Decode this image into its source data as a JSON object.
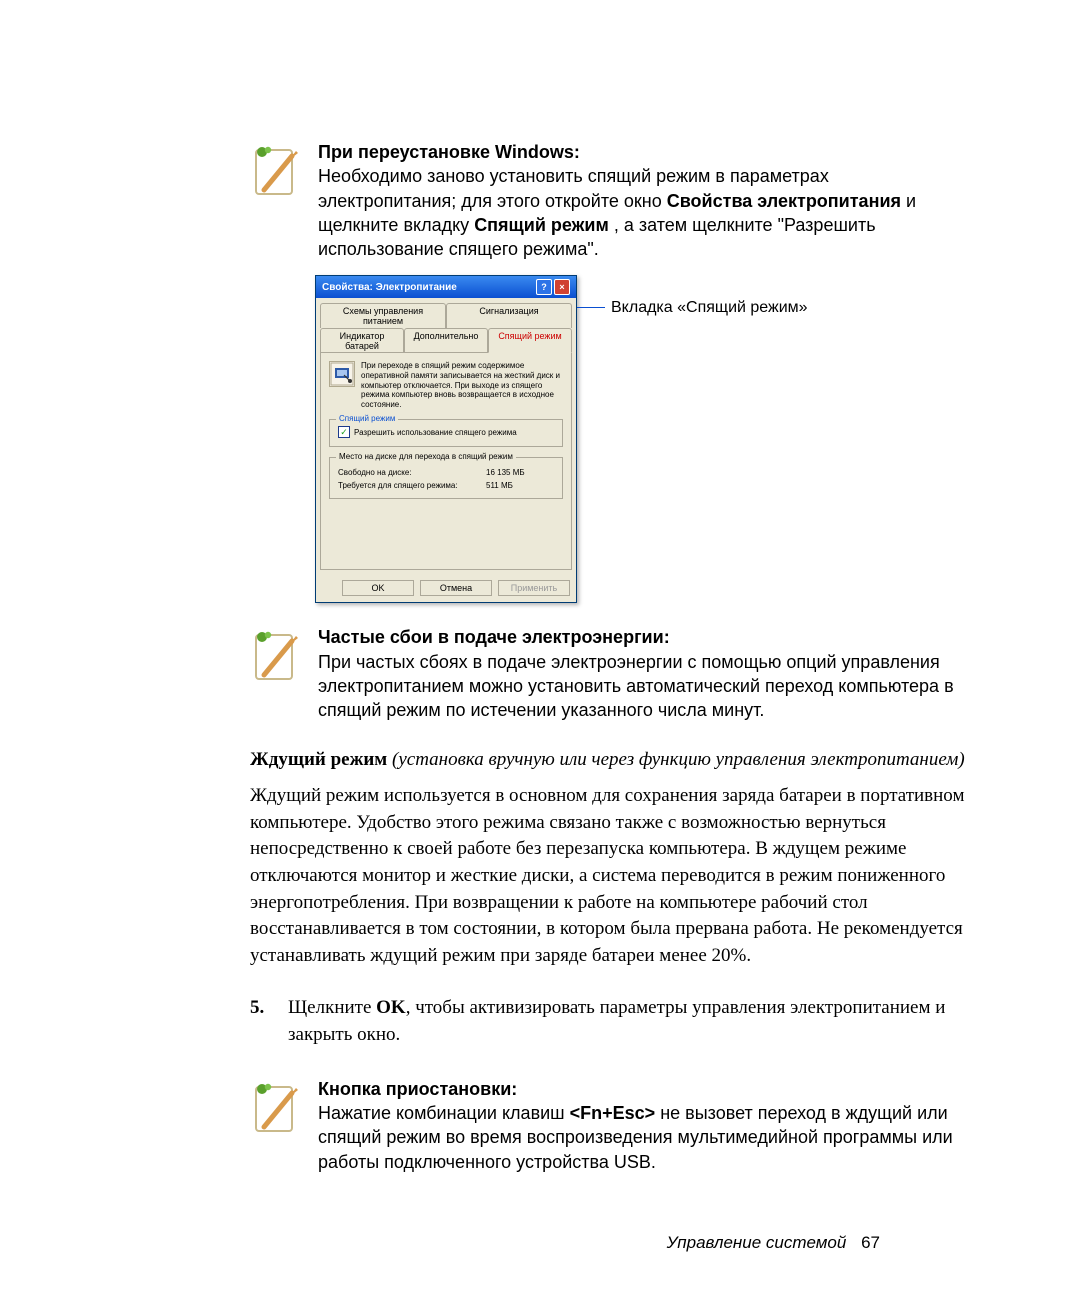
{
  "note1": {
    "heading": "При переустановке Windows:",
    "body_pre": "Необходимо заново установить спящий режим в параметрах электропитания; для этого откройте окно ",
    "bold1": "Свойства электропитания",
    "body_mid": " и щелкните вкладку ",
    "bold2": "Спящий режим",
    "body_end": ", а затем щелкните \"Разрешить использование спящего режима\"."
  },
  "dialog": {
    "title": "Свойства: Электропитание",
    "help": "?",
    "close": "×",
    "tabs_row1": {
      "a": "Схемы управления питанием",
      "b": "Сигнализация"
    },
    "tabs_row2": {
      "a": "Индикатор батарей",
      "b": "Дополнительно",
      "c": "Спящий режим"
    },
    "info": "При переходе в спящий режим содержимое оперативной памяти записывается на жесткий диск и компьютер отключается. При выходе из спящего режима компьютер вновь возвращается в исходное состояние.",
    "group1": {
      "legend": "Спящий режим",
      "chk_label": "Разрешить использование спящего режима"
    },
    "group2": {
      "legend": "Место на диске для перехода в спящий режим",
      "k1": "Свободно на диске:",
      "v1": "16 135 МБ",
      "k2": "Требуется для спящего режима:",
      "v2": "511 МБ"
    },
    "ok": "OK",
    "cancel": "Отмена",
    "apply": "Применить"
  },
  "callout": {
    "label": "Вкладка «Спящий режим»"
  },
  "note2": {
    "heading": "Частые сбои в подаче электроэнергии:",
    "body": "При частых сбоях в подаче электроэнергии с помощью опций управления электропитанием можно установить автоматический переход компьютера в спящий режим по истечении указанного числа минут."
  },
  "serif": {
    "title": "Ждущий режим",
    "paren": " (установка вручную или через функцию управления электропитанием)",
    "body": "Ждущий режим используется в основном для сохранения заряда батареи в портативном компьютере. Удобство этого режима связано также с возможностью вернуться непосредственно к своей работе без перезапуска компьютера. В ждущем режиме отключаются монитор и жесткие диски, а система переводится в режим пониженного энергопотребления. При возвращении к работе на компьютере рабочий стол восстанавливается в том состоянии, в котором была прервана работа. Не рекомендуется устанавливать ждущий режим при заряде батареи менее 20%."
  },
  "step5": {
    "num": "5.",
    "pre": "Щелкните ",
    "bold": "OK",
    "post": ", чтобы активизировать параметры управления электропитанием и закрыть окно."
  },
  "note3": {
    "heading": "Кнопка приостановки:",
    "pre": "Нажатие комбинации клавиш ",
    "bold": "<Fn+Esc>",
    "post": " не вызовет переход в ждущий или спящий режим во время воспроизведения мультимедийной программы или работы подключенного устройства USB."
  },
  "footer": {
    "text": "Управление системой",
    "page": "67"
  },
  "icons": {
    "note": "note-icon"
  }
}
